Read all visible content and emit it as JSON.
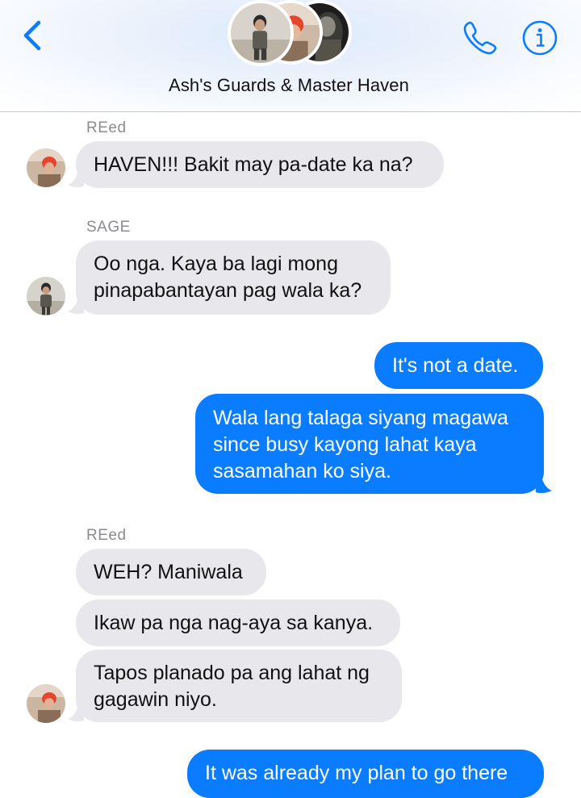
{
  "header": {
    "title": "Ash's Guards & Master Haven",
    "back_icon": "chevron-left-icon",
    "call_icon": "phone-icon",
    "info_icon": "info-icon",
    "accent_color": "#0a7cff"
  },
  "messages": [
    {
      "sender": "REed",
      "direction": "incoming",
      "lines": [
        "HAVEN!!! Bakit may pa-date ka na?"
      ]
    },
    {
      "sender": "SAGE",
      "direction": "incoming",
      "lines": [
        "Oo nga. Kaya ba lagi mong",
        "pinapabantayan pag wala ka?"
      ]
    },
    {
      "sender": "",
      "direction": "outgoing",
      "lines": [
        "It's not a date."
      ]
    },
    {
      "sender": "",
      "direction": "outgoing",
      "lines": [
        "Wala lang talaga siyang magawa",
        "since busy kayong lahat kaya",
        "sasamahan ko siya."
      ]
    },
    {
      "sender": "REed",
      "direction": "incoming",
      "lines": [
        "WEH? Maniwala"
      ]
    },
    {
      "sender": "",
      "direction": "incoming",
      "lines": [
        "Ikaw pa nga nag-aya sa kanya."
      ]
    },
    {
      "sender": "",
      "direction": "incoming",
      "lines": [
        "Tapos planado pa ang lahat ng",
        "gagawin niyo."
      ]
    },
    {
      "sender": "",
      "direction": "outgoing",
      "lines": [
        "It was already my plan to go there"
      ]
    }
  ],
  "colors": {
    "incoming_bubble": "#e8e8ec",
    "outgoing_bubble": "#0a7cff",
    "sender_name": "#8b8b90"
  }
}
